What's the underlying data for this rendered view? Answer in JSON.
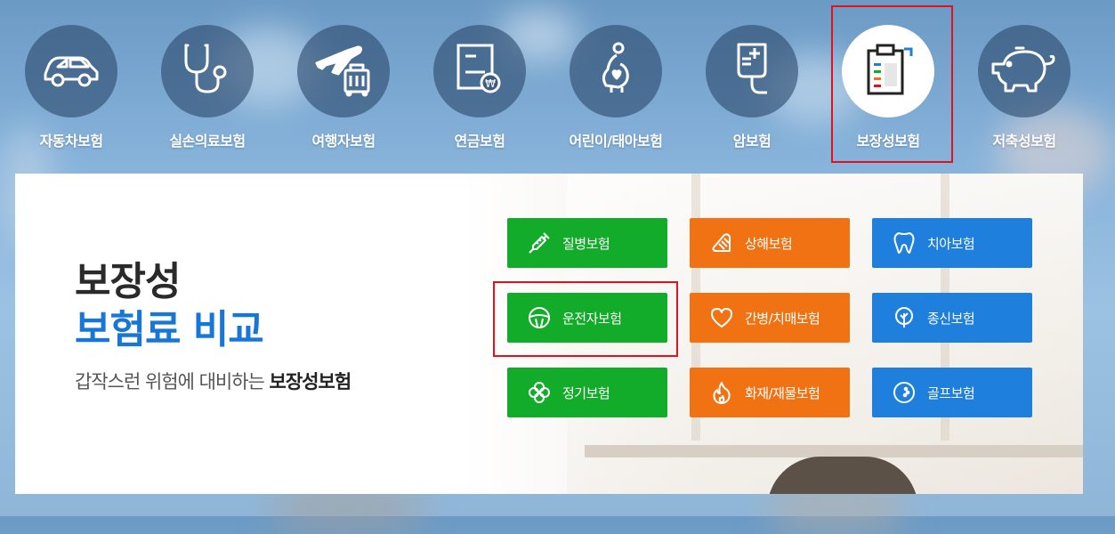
{
  "nav": {
    "items": [
      {
        "label": "자동차보험",
        "icon": "car-icon"
      },
      {
        "label": "실손의료보험",
        "icon": "stethoscope-icon"
      },
      {
        "label": "여행자보험",
        "icon": "airplane-luggage-icon"
      },
      {
        "label": "연금보험",
        "icon": "pension-document-icon"
      },
      {
        "label": "어린이/태아보험",
        "icon": "pregnant-icon"
      },
      {
        "label": "암보험",
        "icon": "iv-bag-icon"
      },
      {
        "label": "보장성보험",
        "icon": "clipboard-icon",
        "active": true
      },
      {
        "label": "저축성보험",
        "icon": "piggy-bank-icon"
      }
    ]
  },
  "hero": {
    "title_line1": "보장성",
    "title_line2": "보험료 비교",
    "subtitle_plain": "갑작스런 위험에 대비하는 ",
    "subtitle_bold": "보장성보험"
  },
  "buttons": [
    {
      "label": "질병보험",
      "icon": "syringe-icon",
      "color": "#13ab2a"
    },
    {
      "label": "상해보험",
      "icon": "bandage-icon",
      "color": "#f07212"
    },
    {
      "label": "치아보험",
      "icon": "tooth-icon",
      "color": "#1f7fdc"
    },
    {
      "label": "운전자보험",
      "icon": "steering-wheel-icon",
      "color": "#13ab2a"
    },
    {
      "label": "간병/치매보험",
      "icon": "heart-icon",
      "color": "#f07212"
    },
    {
      "label": "종신보험",
      "icon": "sprout-icon",
      "color": "#1f7fdc"
    },
    {
      "label": "정기보험",
      "icon": "clover-icon",
      "color": "#13ab2a"
    },
    {
      "label": "화재/재물보험",
      "icon": "fire-icon",
      "color": "#f07212"
    },
    {
      "label": "골프보험",
      "icon": "golf-ball-icon",
      "color": "#1f7fdc"
    }
  ],
  "colors": {
    "green": "#13ab2a",
    "orange": "#f07212",
    "blue": "#1f7fdc",
    "highlight": "#e0121b",
    "title_blue": "#1877d6"
  }
}
